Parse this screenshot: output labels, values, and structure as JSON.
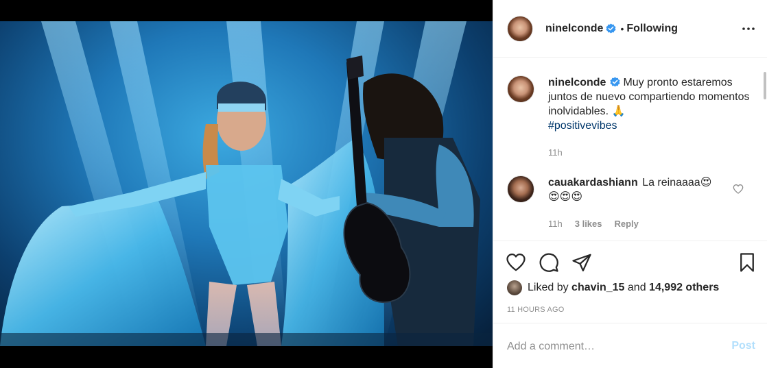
{
  "post": {
    "username": "ninelconde",
    "separator": "•",
    "follow_status": "Following",
    "more_icon": "more-options-icon"
  },
  "caption": {
    "username": "ninelconde",
    "text": "Muy pronto estaremos juntos de nuevo compartiendo momentos inolvidables. 🙏",
    "hashtag": "#positivevibes",
    "time": "11h"
  },
  "comments": [
    {
      "username": "cauakardashiann",
      "text": "La reinaaaa😍",
      "text2": "😍😍😍",
      "time": "11h",
      "likes": "3 likes",
      "reply": "Reply"
    }
  ],
  "likes": {
    "prefix": "Liked by",
    "user": "chavin_15",
    "middle": "and",
    "others": "14,992 others"
  },
  "timestamp": "11 HOURS AGO",
  "add_comment": {
    "placeholder": "Add a comment…",
    "post_label": "Post"
  },
  "colors": {
    "link": "#00376b",
    "verified": "#3897f0",
    "post_disabled": "#b2dffc"
  }
}
